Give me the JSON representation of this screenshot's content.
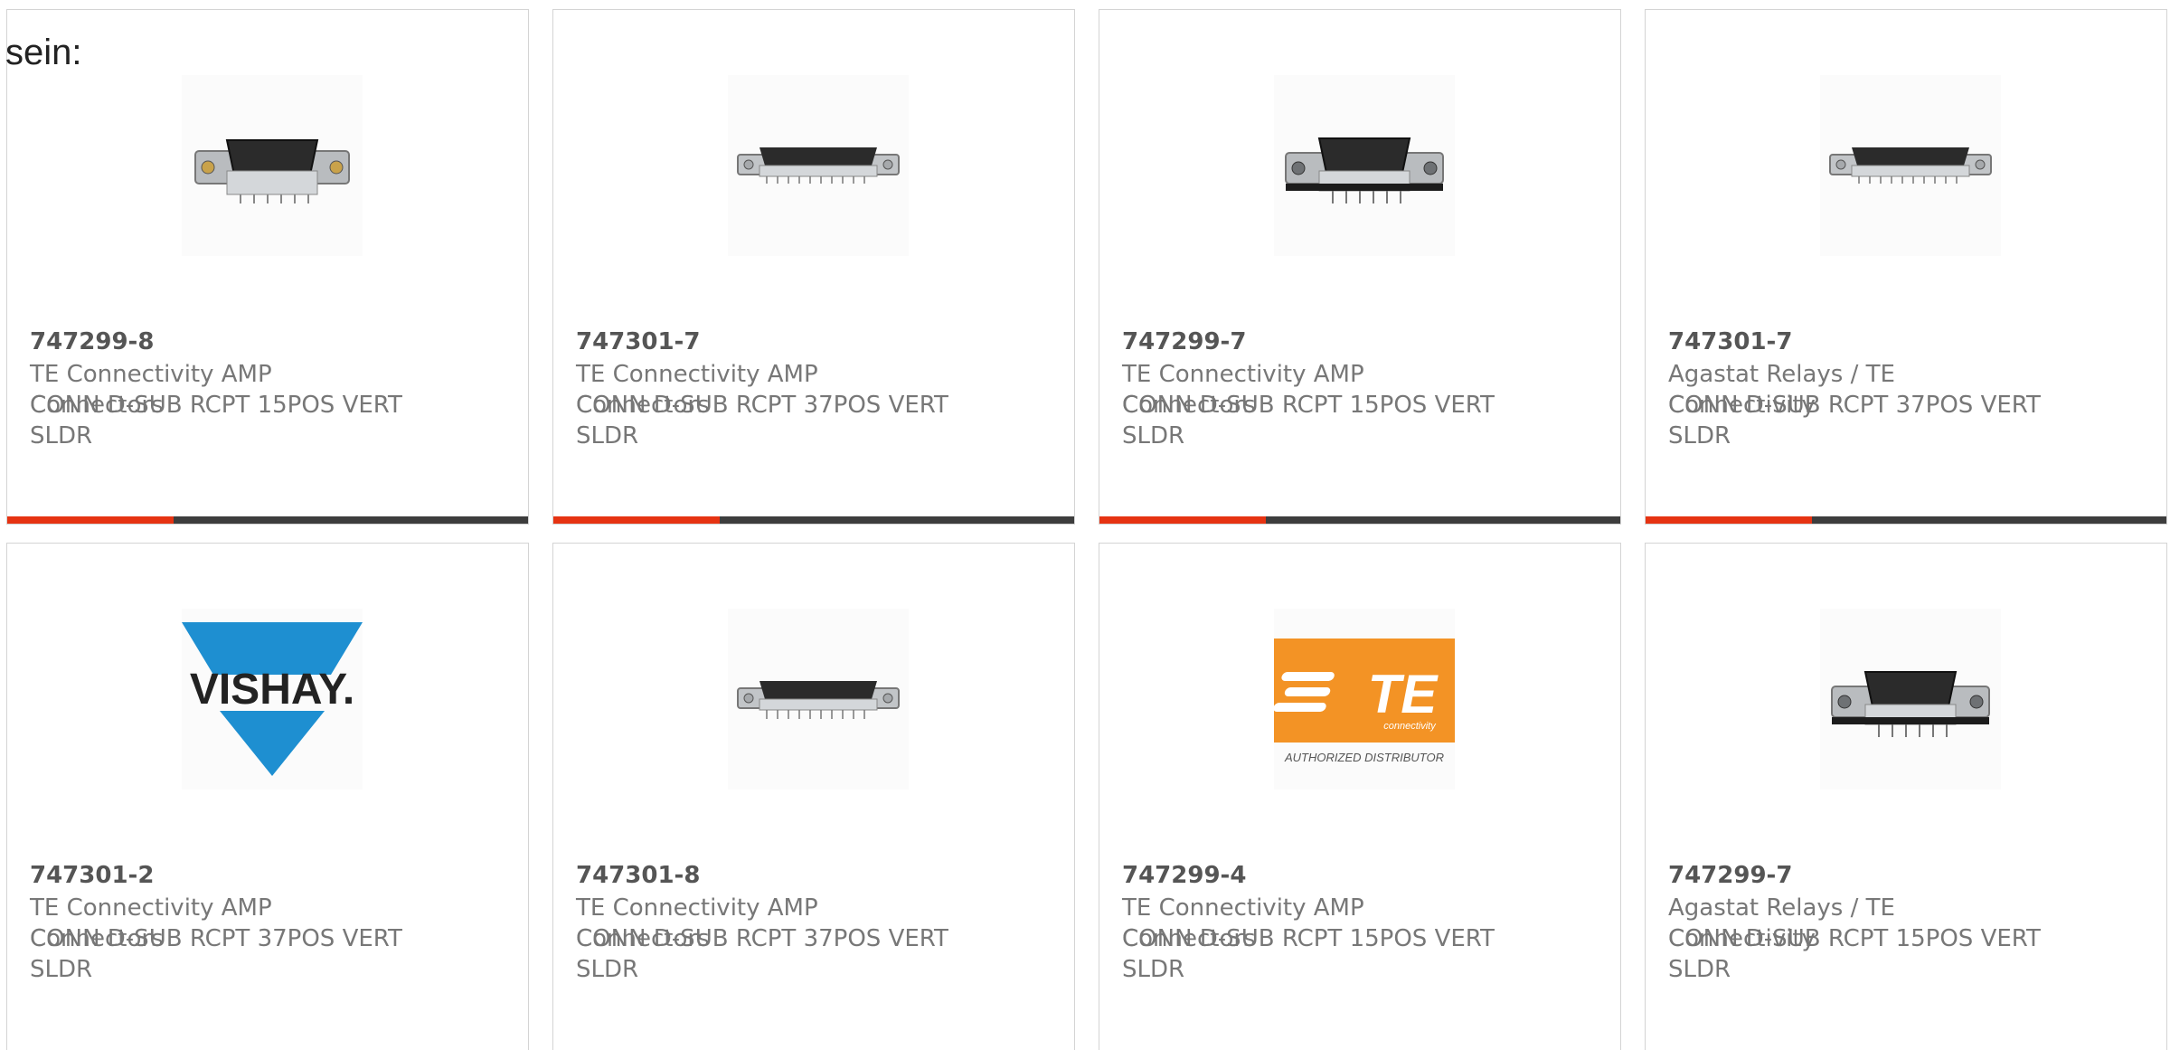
{
  "intro_text": "sein:",
  "colors": {
    "accent": "#e63312",
    "bar_track": "#3d3d3d",
    "part_number": "#555555",
    "body_text": "#777777",
    "vishay_blue": "#1e8fd1",
    "te_orange": "#f39325"
  },
  "products": [
    {
      "part_number": "747299-8",
      "manufacturer": "TE Connectivity AMP Connectors",
      "description": "CONN D-SUB RCPT 15POS VERT SLDR",
      "image": "dsub-15-connector-image",
      "progress": 0.32
    },
    {
      "part_number": "747301-7",
      "manufacturer": "TE Connectivity AMP Connectors",
      "description": "CONN D-SUB RCPT 37POS VERT SLDR",
      "image": "dsub-37-connector-image",
      "progress": 0.32
    },
    {
      "part_number": "747299-7",
      "manufacturer": "TE Connectivity AMP Connectors",
      "description": "CONN D-SUB RCPT 15POS VERT SLDR",
      "image": "dsub-15-connector-image",
      "progress": 0.32
    },
    {
      "part_number": "747301-7",
      "manufacturer": "Agastat Relays / TE Connectivity",
      "description": "CONN D-SUB RCPT 37POS VERT SLDR",
      "image": "dsub-37-connector-image",
      "progress": 0.32
    },
    {
      "part_number": "747301-2",
      "manufacturer": "TE Connectivity AMP Connectors",
      "description": "CONN D-SUB RCPT 37POS VERT SLDR",
      "image": "vishay-logo",
      "logo_text": "VISHAY."
    },
    {
      "part_number": "747301-8",
      "manufacturer": "TE Connectivity AMP Connectors",
      "description": "CONN D-SUB RCPT 37POS VERT SLDR",
      "image": "dsub-37-connector-image"
    },
    {
      "part_number": "747299-4",
      "manufacturer": "TE Connectivity AMP Connectors",
      "description": "CONN D-SUB RCPT 15POS VERT SLDR",
      "image": "te-connectivity-logo",
      "logo_text": "TE",
      "logo_subtext": "connectivity",
      "logo_caption": "AUTHORIZED DISTRIBUTOR"
    },
    {
      "part_number": "747299-7",
      "manufacturer": "Agastat Relays / TE Connectivity",
      "description": "CONN D-SUB RCPT 15POS VERT SLDR",
      "image": "dsub-15-connector-image"
    }
  ]
}
